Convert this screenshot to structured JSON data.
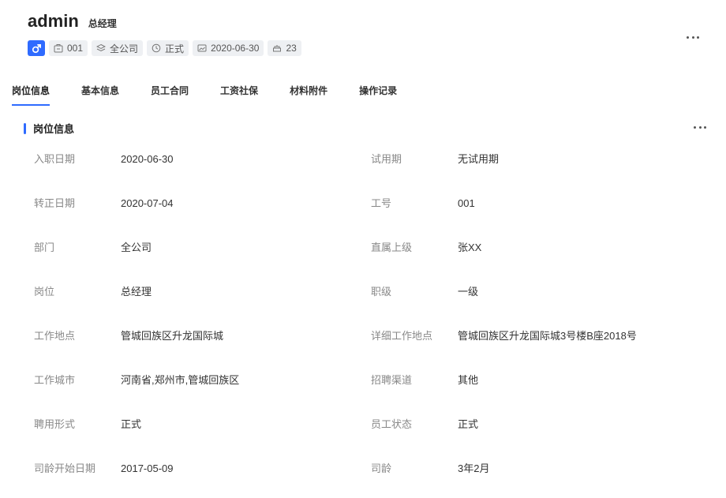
{
  "profile": {
    "username": "admin",
    "position": "总经理",
    "gender_icon": "male-icon",
    "tags": [
      {
        "icon": "id-badge-icon",
        "text": "001"
      },
      {
        "icon": "layers-icon",
        "text": "全公司"
      },
      {
        "icon": "clock-icon",
        "text": "正式"
      },
      {
        "icon": "image-calendar-icon",
        "text": "2020-06-30"
      },
      {
        "icon": "cake-icon",
        "text": "23"
      }
    ]
  },
  "tabs": [
    "岗位信息",
    "基本信息",
    "员工合同",
    "工资社保",
    "材料附件",
    "操作记录"
  ],
  "active_tab": "岗位信息",
  "section": {
    "title": "岗位信息"
  },
  "fields_left": [
    {
      "label": "入职日期",
      "value": "2020-06-30"
    },
    {
      "label": "转正日期",
      "value": "2020-07-04"
    },
    {
      "label": "部门",
      "value": "全公司"
    },
    {
      "label": "岗位",
      "value": "总经理"
    },
    {
      "label": "工作地点",
      "value": "管城回族区升龙国际城"
    },
    {
      "label": "工作城市",
      "value": "河南省,郑州市,管城回族区"
    },
    {
      "label": "聘用形式",
      "value": "正式"
    },
    {
      "label": "司龄开始日期",
      "value": "2017-05-09"
    }
  ],
  "fields_right": [
    {
      "label": "试用期",
      "value": "无试用期"
    },
    {
      "label": "工号",
      "value": "001"
    },
    {
      "label": "直属上级",
      "value": "张XX"
    },
    {
      "label": "职级",
      "value": "一级"
    },
    {
      "label": "详细工作地点",
      "value": "管城回族区升龙国际城3号楼B座2018号"
    },
    {
      "label": "招聘渠道",
      "value": "其他"
    },
    {
      "label": "员工状态",
      "value": "正式"
    },
    {
      "label": "司龄",
      "value": "3年2月"
    }
  ],
  "colors": {
    "accent": "#2f6bff",
    "label": "#888888",
    "value": "#333333",
    "tag_bg": "#eef0f3"
  }
}
